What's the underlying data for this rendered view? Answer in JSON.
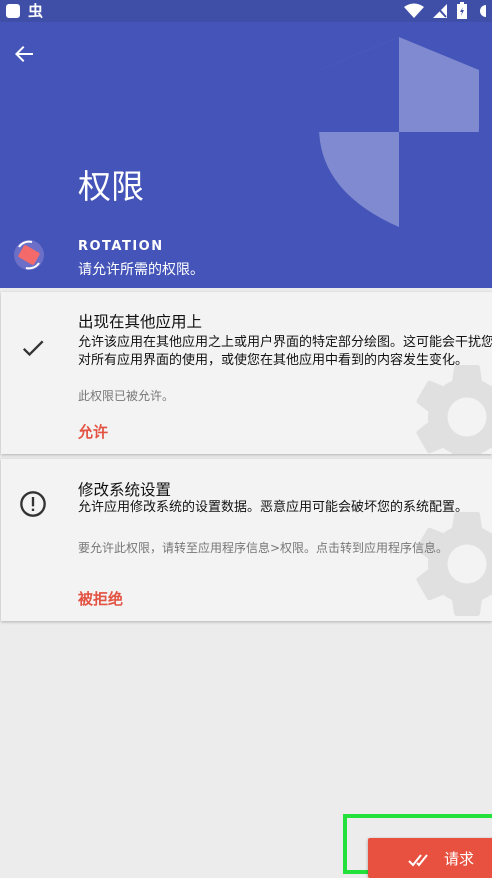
{
  "status_bar": {
    "app_glyph": "虫"
  },
  "header": {
    "title": "权限",
    "app_name": "ROTATION",
    "subtitle": "请允许所需的权限。"
  },
  "permissions": [
    {
      "title": "出现在其他应用上",
      "description": "允许该应用在其他应用之上或用户界面的特定部分绘图。这可能会干扰您对所有应用界面的使用，或使您在其他应用中看到的内容发生变化。",
      "status": "此权限已被允许。",
      "action": "允许",
      "icon": "check-icon"
    },
    {
      "title": "修改系统设置",
      "description": "允许应用修改系统的设置数据。恶意应用可能会破坏您的系统配置。",
      "status": "要允许此权限，请转至应用程序信息>权限。点击转到应用程序信息。",
      "action": "被拒绝",
      "icon": "alert-circle-icon"
    }
  ],
  "request_button": {
    "label": "请求"
  },
  "colors": {
    "header_bg": "#4454b8",
    "status_bar_bg": "#3f4fa8",
    "accent_red": "#e35343",
    "highlight_green": "#23e03a"
  }
}
